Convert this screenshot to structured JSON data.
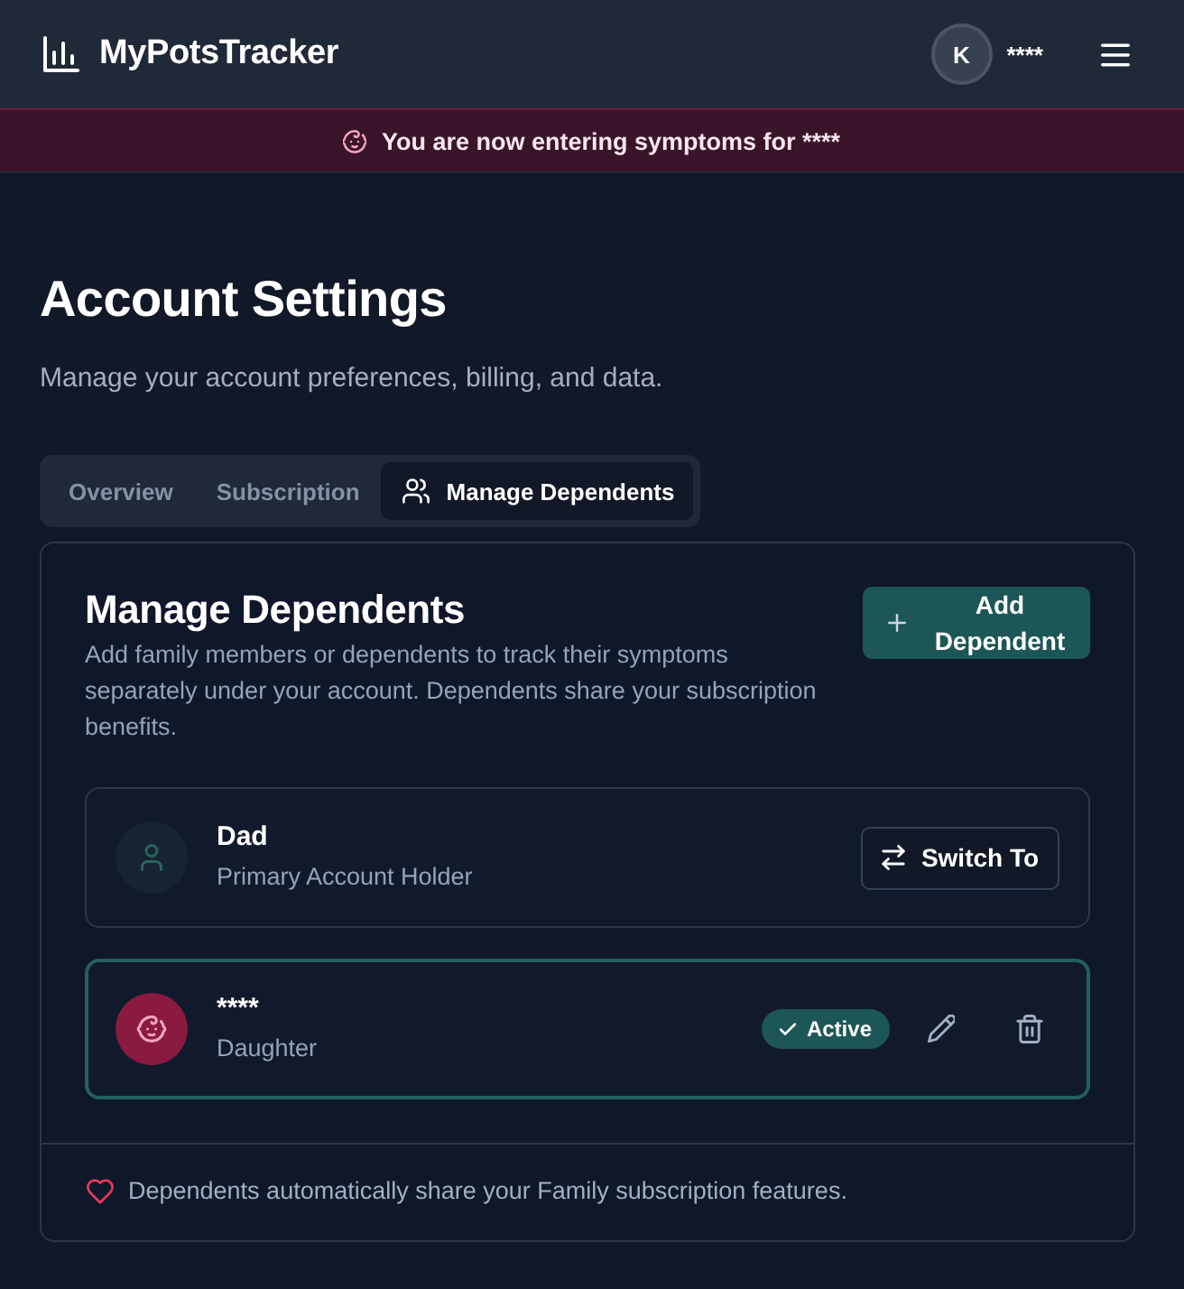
{
  "header": {
    "logo": "MyPotsTracker",
    "user": {
      "initial": "K",
      "name": "****"
    }
  },
  "banner": {
    "text": "You are now entering symptoms for ****"
  },
  "page": {
    "title": "Account Settings",
    "subtitle": "Manage your account preferences, billing, and data."
  },
  "tabs": [
    {
      "label": "Overview",
      "selected": false
    },
    {
      "label": "Subscription",
      "selected": false
    },
    {
      "label": "Manage Dependents",
      "selected": true
    }
  ],
  "section": {
    "title": "Manage Dependents",
    "description": "Add family members or dependents to track their symptoms separately under your account. Dependents share your subscription benefits.",
    "add_button": "Add Dependent"
  },
  "dependents": [
    {
      "kind": "primary",
      "name": "Dad",
      "relation": "Primary Account Holder",
      "active": false,
      "action": "Switch To"
    },
    {
      "kind": "child",
      "name": "****",
      "relation": "Daughter",
      "active": true,
      "badge": "Active"
    }
  ],
  "footer_note": "Dependents automatically share your Family subscription features."
}
